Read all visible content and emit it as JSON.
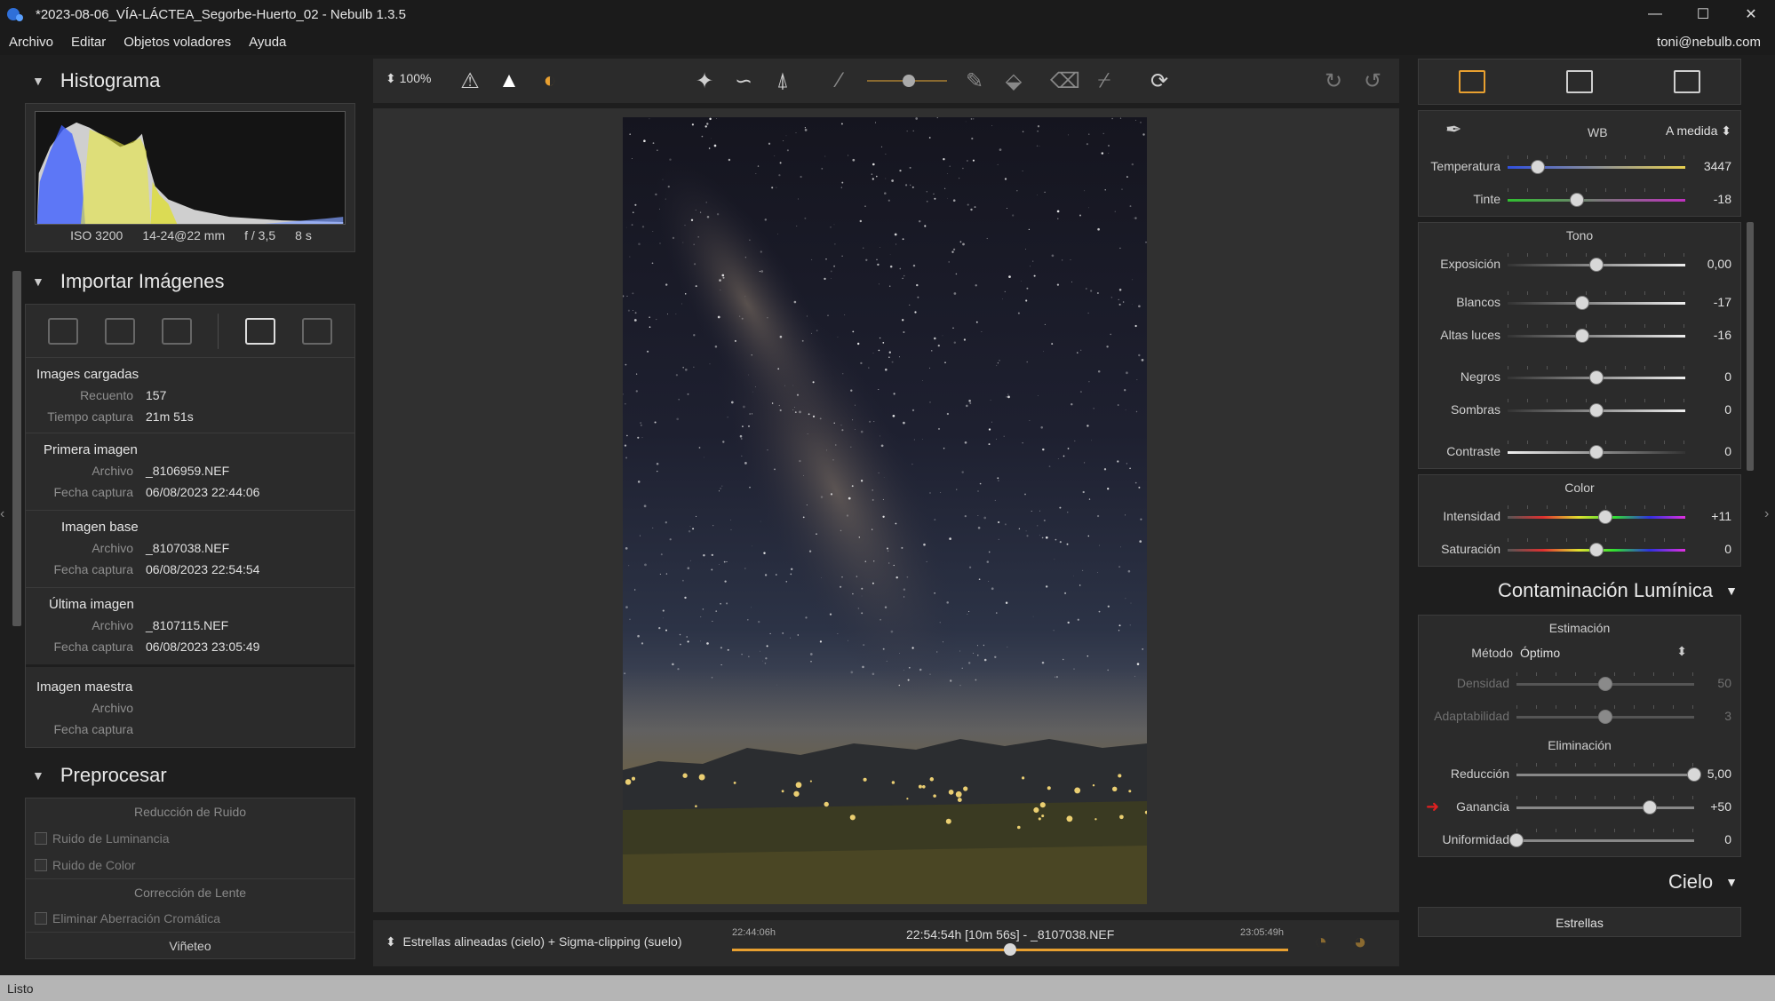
{
  "window": {
    "title": "*2023-08-06_VÍA-LÁCTEA_Segorbe-Huerto_02 - Nebulb 1.3.5",
    "minimize": "—",
    "maximize": "☐",
    "close": "✕"
  },
  "menu": {
    "items": [
      "Archivo",
      "Editar",
      "Objetos voladores",
      "Ayuda"
    ],
    "user": "toni@nebulb.com"
  },
  "histogram": {
    "title": "Histograma",
    "iso": "ISO 3200",
    "lens": "14-24@22 mm",
    "aperture": "f / 3,5",
    "exposure": "8 s"
  },
  "import": {
    "title": "Importar Imágenes",
    "loaded": {
      "heading": "Images cargadas",
      "count_label": "Recuento",
      "count": "157",
      "time_label": "Tiempo captura",
      "time": "21m 51s"
    },
    "first": {
      "heading": "Primera imagen",
      "file_label": "Archivo",
      "file": "_8106959.NEF",
      "date_label": "Fecha captura",
      "date": "06/08/2023 22:44:06"
    },
    "base": {
      "heading": "Imagen base",
      "file_label": "Archivo",
      "file": "_8107038.NEF",
      "date_label": "Fecha captura",
      "date": "06/08/2023 22:54:54"
    },
    "last": {
      "heading": "Última imagen",
      "file_label": "Archivo",
      "file": "_8107115.NEF",
      "date_label": "Fecha captura",
      "date": "06/08/2023 23:05:49"
    },
    "master": {
      "heading": "Imagen maestra",
      "file_label": "Archivo",
      "date_label": "Fecha captura"
    }
  },
  "preprocess": {
    "title": "Preprocesar",
    "noise_heading": "Reducción de Ruido",
    "luminance": "Ruido de Luminancia",
    "color": "Ruido de Color",
    "lens_heading": "Corrección de Lente",
    "aberration": "Eliminar Aberración Cromática",
    "vignette": "Viñeteo"
  },
  "toolbar": {
    "zoom": "100%"
  },
  "timeline": {
    "mode": "Estrellas alineadas (cielo) + Sigma-clipping (suelo)",
    "start": "22:44:06h",
    "current": "22:54:54h [10m 56s] - _8107038.NEF",
    "end": "23:05:49h",
    "position": 0.5
  },
  "adjust": {
    "wb_label": "WB",
    "wb_value": "A medida",
    "temperatura": {
      "label": "Temperatura",
      "value": "3447",
      "pos": 0.17
    },
    "tinte": {
      "label": "Tinte",
      "value": "-18",
      "pos": 0.39
    },
    "tono_heading": "Tono",
    "exposicion": {
      "label": "Exposición",
      "value": "0,00",
      "pos": 0.5
    },
    "blancos": {
      "label": "Blancos",
      "value": "-17",
      "pos": 0.42
    },
    "altas": {
      "label": "Altas luces",
      "value": "-16",
      "pos": 0.42
    },
    "negros": {
      "label": "Negros",
      "value": "0",
      "pos": 0.5
    },
    "sombras": {
      "label": "Sombras",
      "value": "0",
      "pos": 0.5
    },
    "contraste": {
      "label": "Contraste",
      "value": "0",
      "pos": 0.5
    },
    "color_heading": "Color",
    "intensidad": {
      "label": "Intensidad",
      "value": "+11",
      "pos": 0.55
    },
    "saturacion": {
      "label": "Saturación",
      "value": "0",
      "pos": 0.5
    }
  },
  "light_pollution": {
    "title": "Contaminación Lumínica",
    "estimation_heading": "Estimación",
    "method_label": "Método",
    "method_value": "Óptimo",
    "densidad": {
      "label": "Densidad",
      "value": "50",
      "pos": 0.5
    },
    "adaptabilidad": {
      "label": "Adaptabilidad",
      "value": "3",
      "pos": 0.5
    },
    "elimination_heading": "Eliminación",
    "reduccion": {
      "label": "Reducción",
      "value": "5,00",
      "pos": 1.0
    },
    "ganancia": {
      "label": "Ganancia",
      "value": "+50",
      "pos": 0.75
    },
    "uniformidad": {
      "label": "Uniformidad",
      "value": "0",
      "pos": 0.0
    }
  },
  "sky": {
    "title": "Cielo",
    "stars_button": "Estrellas"
  },
  "status": {
    "text": "Listo"
  },
  "colors": {
    "accent": "#e8a030",
    "panel": "#2b2b2b",
    "bg": "#1e1e1e",
    "marker": "#e02020"
  }
}
